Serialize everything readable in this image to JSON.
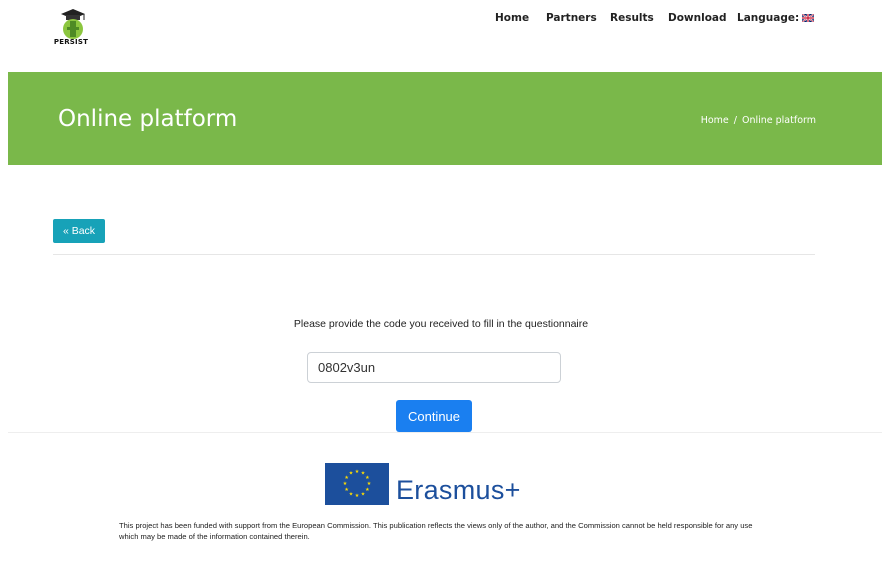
{
  "header": {
    "logo_text": "PERSIST",
    "nav": {
      "home": "Home",
      "partners": "Partners",
      "results": "Results",
      "download": "Download",
      "language": "Language:"
    },
    "language_flag": "uk-flag-icon"
  },
  "banner": {
    "title": "Online platform",
    "breadcrumb": {
      "home": "Home",
      "separator": "/",
      "current": "Online platform"
    },
    "color": "#7ab84a"
  },
  "back_button": {
    "label": "« Back",
    "color": "#17a2b8"
  },
  "form": {
    "prompt": "Please provide the code you received to fill in the questionnaire",
    "code_value": "0802v3un",
    "continue_label": "Continue",
    "continue_color": "#1a7ff0"
  },
  "footer": {
    "program": "Erasmus+",
    "eu_flag": "eu-flag-icon",
    "disclaimer": "This project has been funded with support from the European Commission. This publication reflects the views only of the author, and the Commission cannot be held responsible for any use which may be made of the information contained therein."
  }
}
